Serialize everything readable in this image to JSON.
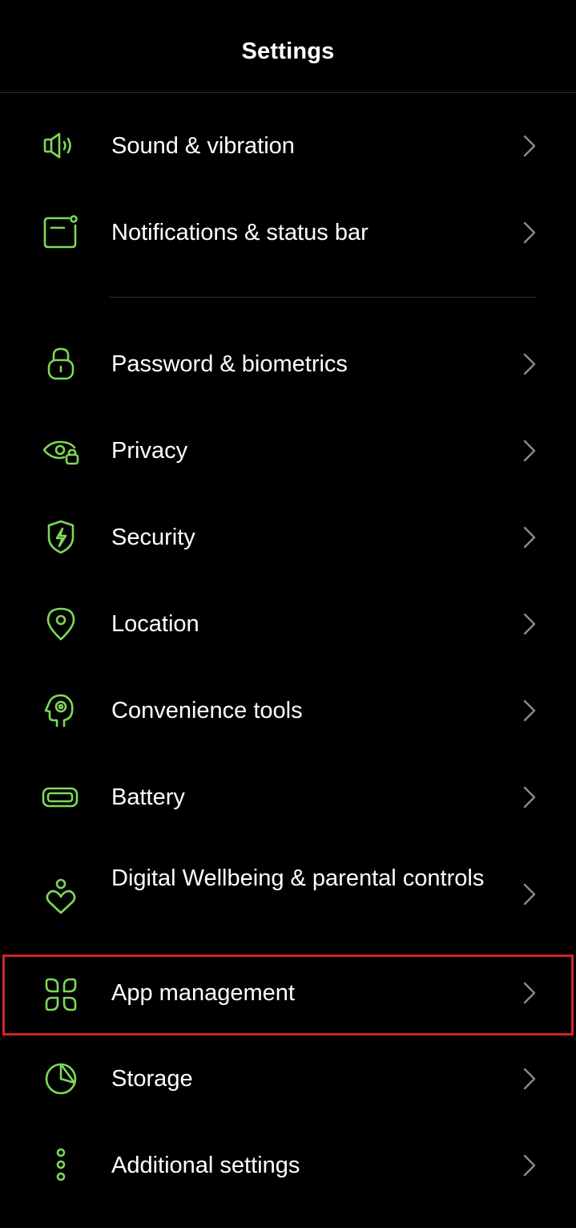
{
  "header": {
    "title": "Settings"
  },
  "colors": {
    "accent": "#7ed957",
    "background": "#000000",
    "highlight": "#d1232a"
  },
  "items": [
    {
      "label": "Sound & vibration",
      "icon": "speaker-icon"
    },
    {
      "label": "Notifications & status bar",
      "icon": "notification-icon"
    },
    {
      "label": "Password & biometrics",
      "icon": "lock-icon"
    },
    {
      "label": "Privacy",
      "icon": "privacy-eye-icon"
    },
    {
      "label": "Security",
      "icon": "shield-icon"
    },
    {
      "label": "Location",
      "icon": "location-pin-icon"
    },
    {
      "label": "Convenience tools",
      "icon": "convenience-tools-icon"
    },
    {
      "label": "Battery",
      "icon": "battery-icon"
    },
    {
      "label": "Digital Wellbeing & parental controls",
      "icon": "wellbeing-icon"
    },
    {
      "label": "App management",
      "icon": "app-grid-icon"
    },
    {
      "label": "Storage",
      "icon": "storage-pie-icon"
    },
    {
      "label": "Additional settings",
      "icon": "more-dots-icon"
    }
  ]
}
